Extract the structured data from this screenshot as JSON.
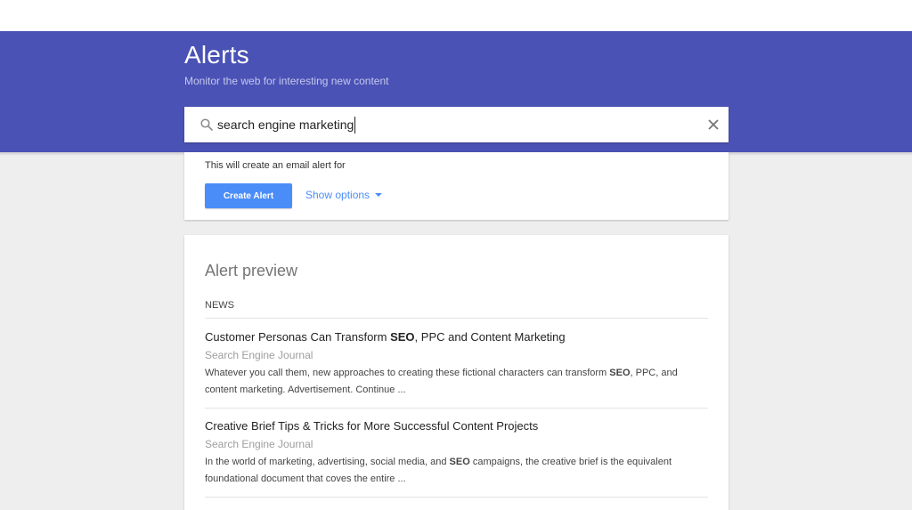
{
  "header": {
    "title": "Alerts",
    "subtitle": "Monitor the web for interesting new content"
  },
  "search": {
    "value": "search engine marketing"
  },
  "create_card": {
    "info_text": "This will create an email alert for",
    "create_button": "Create Alert",
    "show_options": "Show options"
  },
  "preview": {
    "title": "Alert preview",
    "section": "NEWS",
    "articles": [
      {
        "title_parts": [
          "Customer Personas Can Transform ",
          "SEO",
          ", PPC and Content Marketing"
        ],
        "source": "Search Engine Journal",
        "snippet_parts": [
          "Whatever you call them, new approaches to creating these fictional characters can transform ",
          "SEO",
          ", PPC, and content marketing. Advertisement. Continue ..."
        ]
      },
      {
        "title": "Creative Brief Tips & Tricks for More Successful Content Projects",
        "source": "Search Engine Journal",
        "snippet_parts": [
          "In the world of marketing, advertising, social media, and ",
          "SEO",
          " campaigns, the creative brief is the equivalent foundational document that coves the entire ..."
        ]
      }
    ]
  },
  "colors": {
    "header_bg": "#4a52b5",
    "button_bg": "#4b8df8",
    "link": "#4b8df8"
  }
}
